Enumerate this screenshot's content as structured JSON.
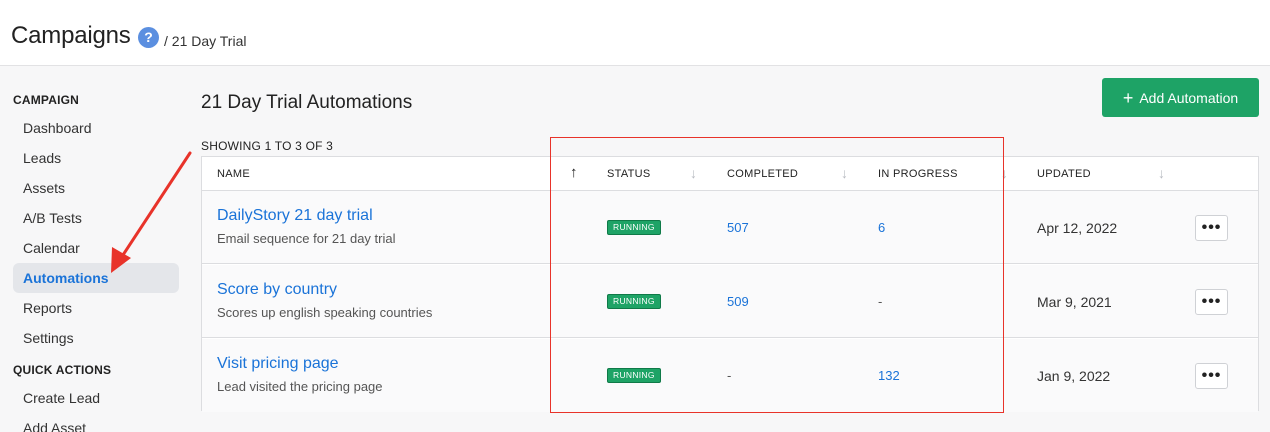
{
  "header": {
    "title": "Campaigns",
    "help_icon": "?",
    "breadcrumb": "/ 21 Day Trial"
  },
  "sidebar": {
    "section_campaign": "CAMPAIGN",
    "items": [
      "Dashboard",
      "Leads",
      "Assets",
      "A/B Tests",
      "Calendar",
      "Automations",
      "Reports",
      "Settings"
    ],
    "active": "Automations",
    "section_quick": "QUICK ACTIONS",
    "quick_items": [
      "Create Lead",
      "Add Asset"
    ]
  },
  "main": {
    "title": "21 Day Trial Automations",
    "add_button": "Add Automation",
    "add_icon": "+",
    "showing": "SHOWING 1 TO 3 OF 3",
    "columns": {
      "name": "NAME",
      "status": "STATUS",
      "completed": "COMPLETED",
      "in_progress": "IN PROGRESS",
      "updated": "UPDATED"
    },
    "rows": [
      {
        "name": "DailyStory 21 day trial",
        "description": "Email sequence for 21 day trial",
        "status": "RUNNING",
        "completed": "507",
        "in_progress": "6",
        "updated": "Apr 12, 2022"
      },
      {
        "name": "Score by country",
        "description": "Scores up english speaking countries",
        "status": "RUNNING",
        "completed": "509",
        "in_progress": "-",
        "updated": "Mar 9, 2021"
      },
      {
        "name": "Visit pricing page",
        "description": "Lead visited the pricing page",
        "status": "RUNNING",
        "completed": "-",
        "in_progress": "132",
        "updated": "Jan 9, 2022"
      }
    ],
    "more_icon": "•••"
  },
  "colors": {
    "accent": "#1a73d8",
    "button_green": "#1ea366",
    "annotation_red": "#e8332a",
    "help_blue": "#5b8fe0"
  }
}
